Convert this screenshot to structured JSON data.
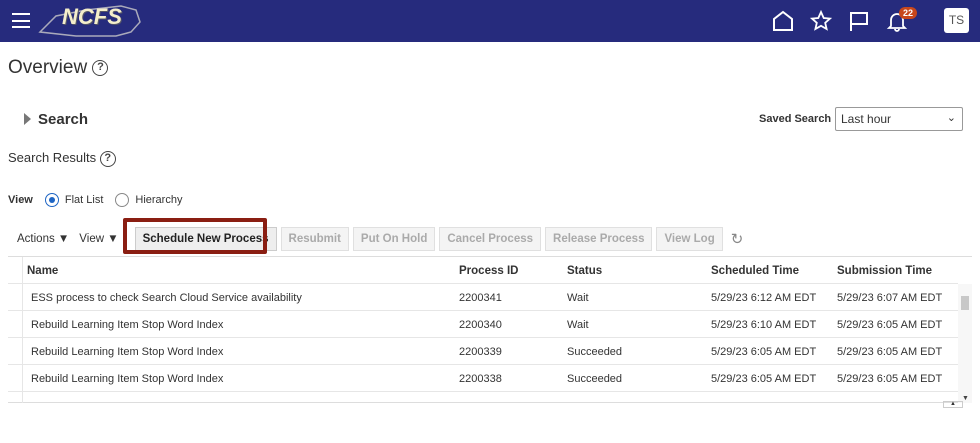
{
  "header": {
    "logo": "NCFS",
    "notification_count": "22",
    "user_initials": "TS"
  },
  "page": {
    "title": "Overview",
    "search_label": "Search",
    "saved_search_label": "Saved Search",
    "saved_search_value": "Last hour",
    "results_title": "Search Results"
  },
  "view": {
    "label": "View",
    "options": [
      "Flat List",
      "Hierarchy"
    ],
    "selected": "Flat List"
  },
  "toolbar": {
    "actions": "Actions",
    "view": "View",
    "buttons": [
      "Schedule New Process",
      "Resubmit",
      "Put On Hold",
      "Cancel Process",
      "Release Process",
      "View Log"
    ]
  },
  "table": {
    "columns": [
      "Name",
      "Process ID",
      "Status",
      "Scheduled Time",
      "Submission Time"
    ],
    "rows": [
      [
        "ESS process to check Search Cloud Service availability",
        "2200341",
        "Wait",
        "5/29/23 6:12 AM EDT",
        "5/29/23 6:07 AM EDT"
      ],
      [
        "Rebuild Learning Item Stop Word Index",
        "2200340",
        "Wait",
        "5/29/23 6:10 AM EDT",
        "5/29/23 6:05 AM EDT"
      ],
      [
        "Rebuild Learning Item Stop Word Index",
        "2200339",
        "Succeeded",
        "5/29/23 6:05 AM EDT",
        "5/29/23 6:05 AM EDT"
      ],
      [
        "Rebuild Learning Item Stop Word Index",
        "2200338",
        "Succeeded",
        "5/29/23 6:05 AM EDT",
        "5/29/23 6:05 AM EDT"
      ]
    ]
  },
  "colors": {
    "topbar": "#262b7d",
    "highlight": "#8a1e12",
    "badge": "#c7471c"
  }
}
